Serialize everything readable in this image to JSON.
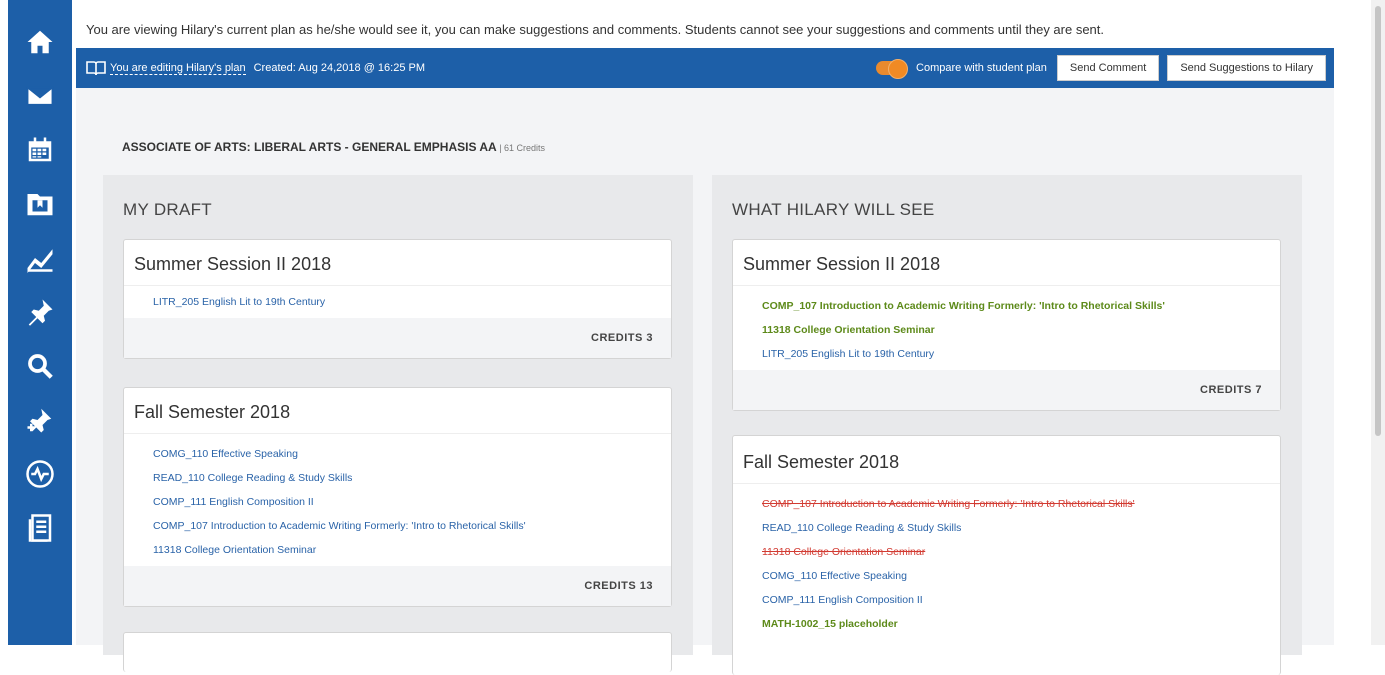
{
  "notice": "You are viewing Hilary's current plan as he/she would see it, you can make suggestions and comments. Students cannot see your suggestions and comments until they are sent.",
  "editbar": {
    "editing_label": "You are editing Hilary's plan",
    "created_label": "Created: Aug 24,2018 @ 16:25 PM",
    "compare_label": "Compare with student plan",
    "send_comment": "Send Comment",
    "send_suggestions": "Send Suggestions to Hilary"
  },
  "program": {
    "name": "ASSOCIATE OF ARTS: LIBERAL ARTS - GENERAL EMPHASIS AA",
    "credits": " | 61 Credits"
  },
  "draft": {
    "title": "MY DRAFT",
    "terms": [
      {
        "name": "Summer Session II 2018",
        "courses": [
          {
            "label": "LITR_205 English Lit to 19th Century"
          }
        ],
        "credits": "CREDITS 3"
      },
      {
        "name": "Fall Semester 2018",
        "courses": [
          {
            "label": "COMG_110 Effective Speaking"
          },
          {
            "label": "READ_110 College Reading & Study Skills"
          },
          {
            "label": "COMP_111 English Composition II"
          },
          {
            "label": "COMP_107 Introduction to Academic Writing Formerly: 'Intro to Rhetorical Skills'"
          },
          {
            "label": "11318 College Orientation Seminar"
          }
        ],
        "credits": "CREDITS 13"
      }
    ]
  },
  "preview": {
    "title": "WHAT HILARY WILL SEE",
    "terms": [
      {
        "name": "Summer Session II 2018",
        "courses": [
          {
            "label": "COMP_107 Introduction to Academic Writing Formerly: 'Intro to Rhetorical Skills'",
            "status": "added"
          },
          {
            "label": "11318 College Orientation Seminar",
            "status": "added"
          },
          {
            "label": "LITR_205 English Lit to 19th Century",
            "status": "normal"
          }
        ],
        "credits": "CREDITS 7"
      },
      {
        "name": "Fall Semester 2018",
        "courses": [
          {
            "label": "COMP_107 Introduction to Academic Writing Formerly: 'Intro to Rhetorical Skills'",
            "status": "removed"
          },
          {
            "label": "READ_110 College Reading & Study Skills",
            "status": "normal"
          },
          {
            "label": "11318 College Orientation Seminar",
            "status": "removed"
          },
          {
            "label": "COMG_110 Effective Speaking",
            "status": "normal"
          },
          {
            "label": "COMP_111 English Composition II",
            "status": "normal"
          },
          {
            "label": "MATH-1002_15 placeholder",
            "status": "added"
          }
        ]
      }
    ]
  },
  "colors": {
    "brand": "#1d5fa8",
    "added": "#5d8a1a",
    "removed": "#d23b32",
    "link": "#2a63a8",
    "toggle": "#f08a24"
  },
  "sidebar_icons": [
    "home-icon",
    "mail-icon",
    "calendar-icon",
    "folder-icon",
    "chart-icon",
    "pin-icon",
    "search-icon",
    "pin-add-icon",
    "pulse-icon",
    "document-icon"
  ]
}
